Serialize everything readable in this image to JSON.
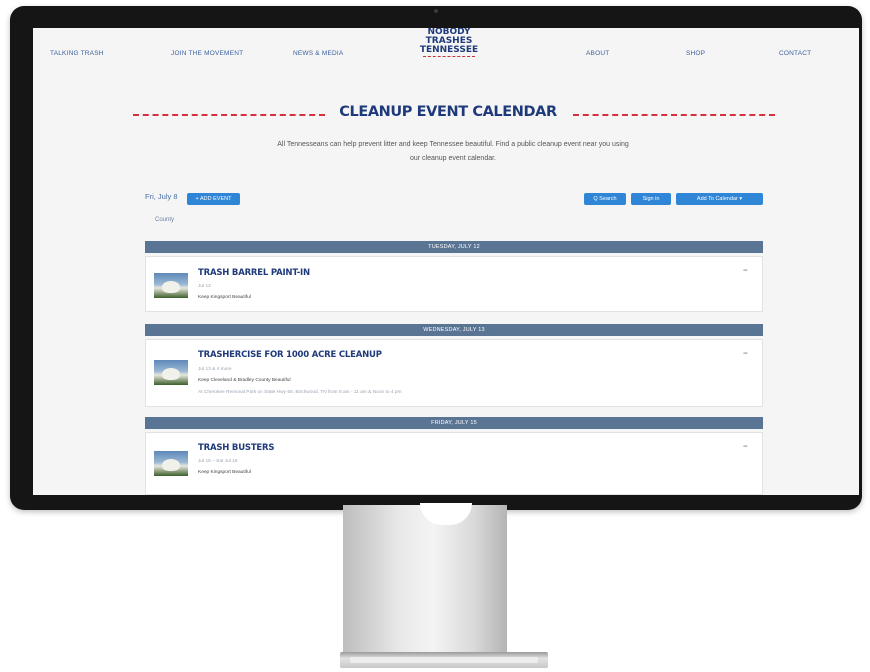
{
  "nav": {
    "items": [
      "TALKING TRASH",
      "JOIN THE MOVEMENT",
      "NEWS & MEDIA",
      "ABOUT",
      "SHOP",
      "CONTACT"
    ],
    "logo_lines": [
      "NOBODY",
      "TRASHES",
      "TENNESSEE"
    ]
  },
  "page": {
    "title": "CLEANUP EVENT CALENDAR",
    "intro_line1": "All Tennesseans can help prevent litter and keep Tennessee beautiful. Find a public cleanup event near you using",
    "intro_line2": "our cleanup event calendar."
  },
  "toolbar": {
    "date": "Fri, July 8",
    "add_event": "+ ADD EVENT",
    "search": "Q Search",
    "sign_in": "Sign in",
    "add_to_calendar": "Add To Calendar",
    "filter_label": "County"
  },
  "days": [
    {
      "header": "TUESDAY, JULY 12",
      "event": {
        "title": "TRASH BARREL PAINT-IN",
        "date": "Jul 12",
        "org": "Keep Kingsport Beautiful",
        "location": ""
      }
    },
    {
      "header": "WEDNESDAY, JULY 13",
      "event": {
        "title": "TRASHERCISE FOR 1000 ACRE CLEANUP",
        "date": "Jul 13 & 4 more",
        "org": "Keep Cleveland & Bradley County Beautiful",
        "location": "At Cherokee Removal Park on State Hwy 60, Birchwood, TN from 8 am - 11 am & Noon to 4 pm"
      }
    },
    {
      "header": "FRIDAY, JULY 15",
      "event": {
        "title": "TRASH BUSTERS",
        "date": "Jul 15 – Sat Jul 16",
        "org": "Keep Kingsport Beautiful",
        "location": ""
      }
    }
  ],
  "colors": {
    "brand_blue": "#1f3a7a",
    "accent_red": "#d6303e",
    "button_blue": "#2f86d6",
    "day_header": "#5a7594"
  }
}
